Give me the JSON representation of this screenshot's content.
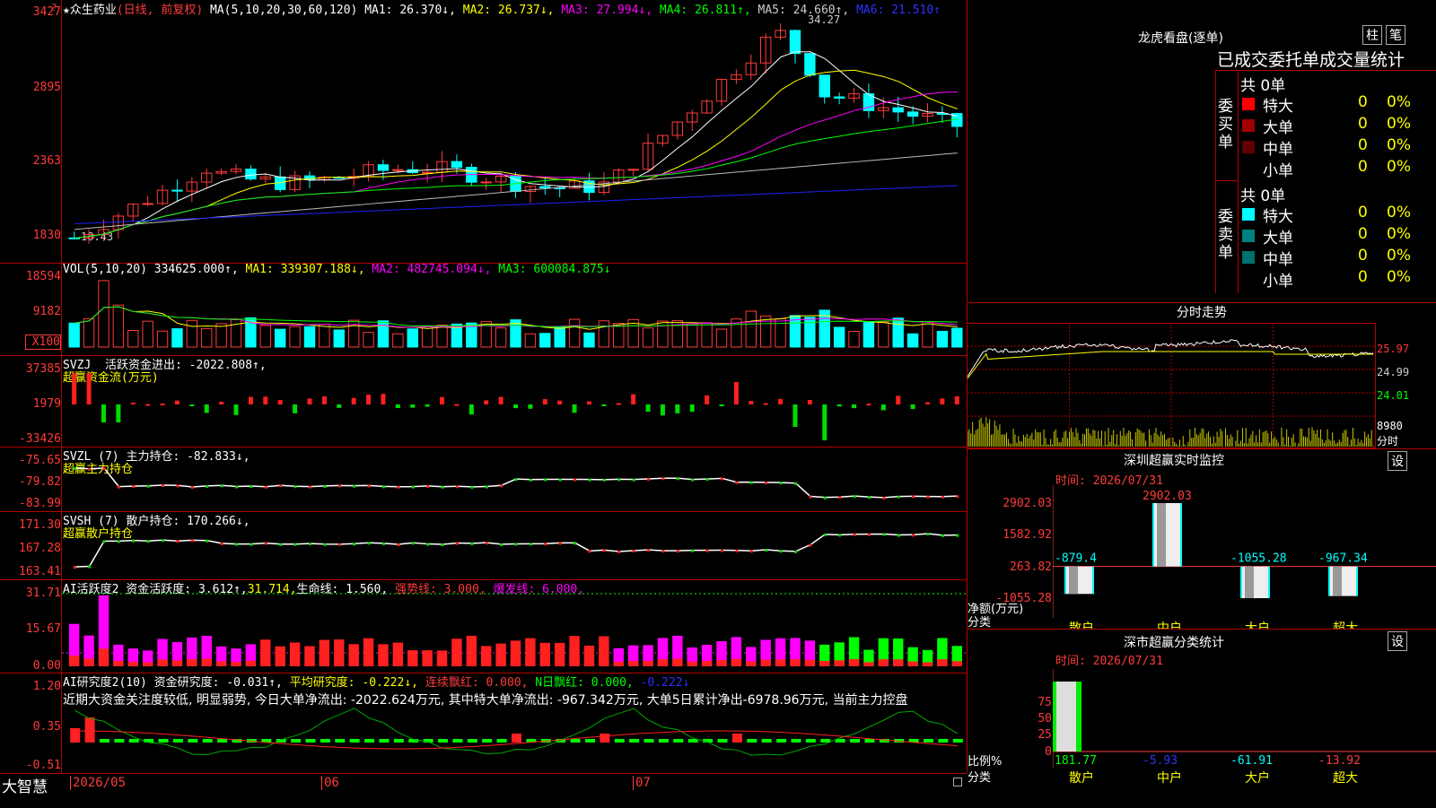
{
  "main_chart": {
    "star": "★",
    "title": "众生药业",
    "mode": "(日线, 前复权)",
    "ma_params": "MA(5,10,20,30,60,120)",
    "ma1": "MA1: 26.370↓,",
    "ma2": "MA2: 26.737↓,",
    "ma3": "MA3: 27.994↓,",
    "ma4": "MA4: 26.811↑,",
    "ma5": "MA5: 24.660↑,",
    "ma6": "MA6: 21.510↑",
    "high_label": "34.27",
    "low_label": "18.43",
    "yaxis": [
      "3427",
      "2895",
      "2363",
      "1830"
    ]
  },
  "volume_panel": {
    "label": "VOL(5,10,20)",
    "value": "334625.000↑,",
    "ma1": "MA1: 339307.188↓,",
    "ma2": "MA2: 482745.094↓,",
    "ma3": "MA3: 600084.875↓",
    "yaxis": [
      "18594",
      "9182"
    ],
    "unit": "X100"
  },
  "svzj_panel": {
    "label": "SVZJ  活跃资金进出: -2022.808↑,",
    "sub": "超赢资金流(万元)",
    "yaxis": [
      "37385",
      "1979",
      "-33426"
    ]
  },
  "svzl_panel": {
    "label": "SVZL (7) 主力持仓: -82.833↓,",
    "sub": "超赢主力持仓",
    "yaxis": [
      "-75.65",
      "-79.82",
      "-83.99"
    ]
  },
  "svsh_panel": {
    "label": "SVSH (7) 散户持仓: 170.266↓,",
    "sub": "超赢散户持仓",
    "yaxis": [
      "171.30",
      "167.28",
      "163.41"
    ]
  },
  "ai_active_panel": {
    "label": "AI活跃度2 资金活跃度: 3.612↑,",
    "v2": "31.714,",
    "life": "生命线: 1.560,",
    "strong": "强势线: 3.000,",
    "burst": "爆发线: 6.000,",
    "yaxis": [
      "31.71",
      "15.67",
      "0.00"
    ]
  },
  "ai_research_panel": {
    "label": "AI研究度2(10) 资金研究度: -0.031↑,",
    "avg": "平均研究度: -0.222↓,",
    "cont": "连续飘红: 0.000,",
    "nday": "N日飘红: 0.000,",
    "last": "-0.222↓",
    "comment": "近期大资金关注度较低, 明显弱势, 今日大单净流出: -2022.624万元, 其中特大单净流出: -967.342万元, 大单5日累计净出-6978.96万元, 当前主力控盘",
    "yaxis": [
      "1.20",
      "0.35",
      "-0.51"
    ]
  },
  "bottom_bar": {
    "brand": "大智慧",
    "dates": [
      "2026/05",
      "06",
      "07"
    ]
  },
  "dragon_panel": {
    "title": "龙虎看盘(逐单)",
    "btn_bar": "柱",
    "btn_pen": "笔",
    "heading": "已成交委托单成交量统计",
    "buy_label": "委买单",
    "sell_label": "委卖单",
    "buy_total": "共 0单",
    "sell_total": "共 0单",
    "buy_rows": [
      {
        "name": "特大",
        "count": "0",
        "pct": "0%",
        "color": "#ff0000"
      },
      {
        "name": "大单",
        "count": "0",
        "pct": "0%",
        "color": "#a00000"
      },
      {
        "name": "中单",
        "count": "0",
        "pct": "0%",
        "color": "#600000"
      },
      {
        "name": "小单",
        "count": "0",
        "pct": "0%",
        "color": ""
      }
    ],
    "sell_rows": [
      {
        "name": "特大",
        "count": "0",
        "pct": "0%",
        "color": "#00ffff"
      },
      {
        "name": "大单",
        "count": "0",
        "pct": "0%",
        "color": "#008080"
      },
      {
        "name": "中单",
        "count": "0",
        "pct": "0%",
        "color": "#007070"
      },
      {
        "name": "小单",
        "count": "0",
        "pct": "0%",
        "color": ""
      }
    ]
  },
  "intraday_panel": {
    "title": "分时走势",
    "yaxis": [
      "25.97",
      "24.99",
      "24.01"
    ],
    "vol": "8980",
    "unit": "分时"
  },
  "sz_monitor": {
    "title": "深圳超赢实时监控",
    "btn": "设",
    "time": "时间: 2026/07/31",
    "yaxis": [
      "2902.03",
      "1582.92",
      "263.82",
      "-1055.28"
    ],
    "ylabel": "净额(万元)",
    "xlabel": "分类",
    "cats": [
      "散户",
      "中户",
      "大户",
      "超大"
    ],
    "values": [
      "-879.4",
      "2902.03",
      "-1055.28",
      "-967.34"
    ]
  },
  "sz_stats": {
    "title": "深市超赢分类统计",
    "btn": "设",
    "time": "时间: 2026/07/31",
    "yaxis": [
      "75",
      "50",
      "25",
      "0"
    ],
    "ylabel": "比例%",
    "xlabel": "分类",
    "cats": [
      "散户",
      "中户",
      "大户",
      "超大"
    ],
    "values": [
      "181.77",
      "-5.93",
      "-61.91",
      "-13.92"
    ]
  },
  "chart_data": {
    "type": "bar",
    "title": "深圳超赢实时监控",
    "categories": [
      "散户",
      "中户",
      "大户",
      "超大"
    ],
    "values": [
      -879.4,
      2902.03,
      -1055.28,
      -967.34
    ],
    "ylabel": "净额(万元)",
    "ylim": [
      -1055.28,
      2902.03
    ]
  }
}
